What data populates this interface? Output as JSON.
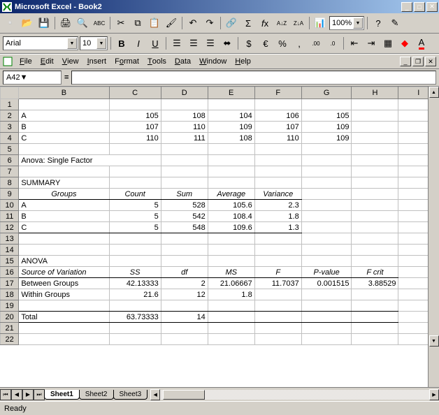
{
  "titlebar": {
    "app": "Microsoft Excel",
    "doc": "Book2"
  },
  "menu": {
    "file": "File",
    "edit": "Edit",
    "view": "View",
    "insert": "Insert",
    "format": "Format",
    "tools": "Tools",
    "data": "Data",
    "window": "Window",
    "help": "Help"
  },
  "font": {
    "name": "Arial",
    "size": "10"
  },
  "zoom": "100%",
  "namebox": "A42",
  "formula": "=",
  "status": "Ready",
  "tabs": {
    "s1": "Sheet1",
    "s2": "Sheet2",
    "s3": "Sheet3"
  },
  "cols": {
    "b": "B",
    "c": "C",
    "d": "D",
    "e": "E",
    "f": "F",
    "g": "G",
    "h": "H",
    "i": "I"
  },
  "rows": {
    "r1": "1",
    "r2": "2",
    "r3": "3",
    "r4": "4",
    "r5": "5",
    "r6": "6",
    "r7": "7",
    "r8": "8",
    "r9": "9",
    "r10": "10",
    "r11": "11",
    "r12": "12",
    "r13": "13",
    "r14": "14",
    "r15": "15",
    "r16": "16",
    "r17": "17",
    "r18": "18",
    "r19": "19",
    "r20": "20",
    "r21": "21",
    "r22": "22"
  },
  "cells": {
    "b2": "A",
    "c2": "105",
    "d2": "108",
    "e2": "104",
    "f2": "106",
    "g2": "105",
    "b3": "B",
    "c3": "107",
    "d3": "110",
    "e3": "109",
    "f3": "107",
    "g3": "109",
    "b4": "C",
    "c4": "110",
    "d4": "111",
    "e4": "108",
    "f4": "110",
    "g4": "109",
    "b6": "Anova: Single Factor",
    "b8": "SUMMARY",
    "b9": "Groups",
    "c9": "Count",
    "d9": "Sum",
    "e9": "Average",
    "f9": "Variance",
    "b10": "A",
    "c10": "5",
    "d10": "528",
    "e10": "105.6",
    "f10": "2.3",
    "b11": "B",
    "c11": "5",
    "d11": "542",
    "e11": "108.4",
    "f11": "1.8",
    "b12": "C",
    "c12": "5",
    "d12": "548",
    "e12": "109.6",
    "f12": "1.3",
    "b15": "ANOVA",
    "b16": "Source of Variation",
    "c16": "SS",
    "d16": "df",
    "e16": "MS",
    "f16": "F",
    "g16": "P-value",
    "h16": "F crit",
    "b17": "Between Groups",
    "c17": "42.13333",
    "d17": "2",
    "e17": "21.06667",
    "f17": "11.7037",
    "g17": "0.001515",
    "h17": "3.88529",
    "b18": "Within Groups",
    "c18": "21.6",
    "d18": "12",
    "e18": "1.8",
    "b20": "Total",
    "c20": "63.73333",
    "d20": "14"
  },
  "chart_data": {
    "type": "table",
    "title": "Anova: Single Factor",
    "raw_data": {
      "groups": [
        "A",
        "B",
        "C"
      ],
      "values": {
        "A": [
          105,
          108,
          104,
          106,
          105
        ],
        "B": [
          107,
          110,
          109,
          107,
          109
        ],
        "C": [
          110,
          111,
          108,
          110,
          109
        ]
      }
    },
    "summary": {
      "columns": [
        "Groups",
        "Count",
        "Sum",
        "Average",
        "Variance"
      ],
      "rows": [
        {
          "Groups": "A",
          "Count": 5,
          "Sum": 528,
          "Average": 105.6,
          "Variance": 2.3
        },
        {
          "Groups": "B",
          "Count": 5,
          "Sum": 542,
          "Average": 108.4,
          "Variance": 1.8
        },
        {
          "Groups": "C",
          "Count": 5,
          "Sum": 548,
          "Average": 109.6,
          "Variance": 1.3
        }
      ]
    },
    "anova": {
      "columns": [
        "Source of Variation",
        "SS",
        "df",
        "MS",
        "F",
        "P-value",
        "F crit"
      ],
      "rows": [
        {
          "Source of Variation": "Between Groups",
          "SS": 42.13333,
          "df": 2,
          "MS": 21.06667,
          "F": 11.7037,
          "P-value": 0.001515,
          "F crit": 3.88529
        },
        {
          "Source of Variation": "Within Groups",
          "SS": 21.6,
          "df": 12,
          "MS": 1.8
        },
        {
          "Source of Variation": "Total",
          "SS": 63.73333,
          "df": 14
        }
      ]
    }
  }
}
